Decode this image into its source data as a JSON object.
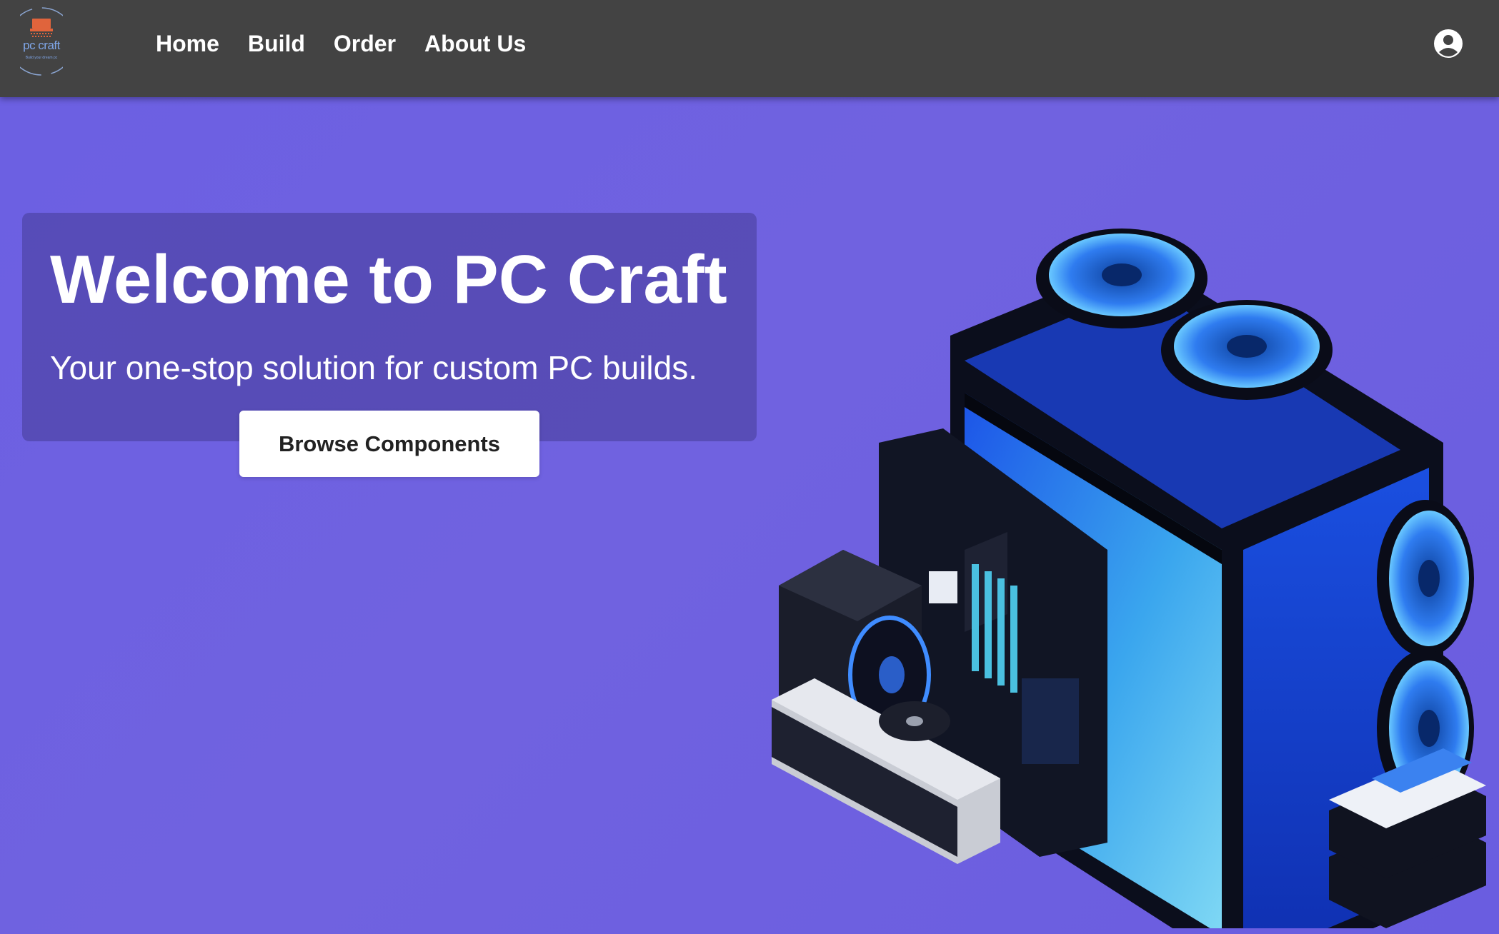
{
  "brand": {
    "logo_text": "pc craft",
    "logo_tagline": "Build your dream pc"
  },
  "nav": {
    "links": [
      {
        "label": "Home"
      },
      {
        "label": "Build"
      },
      {
        "label": "Order"
      },
      {
        "label": "About Us"
      }
    ],
    "account_icon": "user-circle-icon"
  },
  "hero": {
    "title": "Welcome to PC Craft",
    "subtitle": "Your one-stop solution for custom PC builds.",
    "cta_label": "Browse Components"
  },
  "illustration": {
    "subject": "pc-components-illustration",
    "icon_names": [
      "case-fan-icon",
      "pc-case-icon",
      "motherboard-icon",
      "gpu-icon",
      "cpu-cooler-icon",
      "hard-drive-icon"
    ]
  },
  "colors": {
    "nav_bg": "#434343",
    "hero_bg": "#6c60e2",
    "card_bg": "#5a50a8",
    "button_bg": "#ffffff",
    "text_primary": "#ffffff",
    "accent_blue": "#2f7cf0",
    "accent_cyan": "#58c8f0"
  }
}
